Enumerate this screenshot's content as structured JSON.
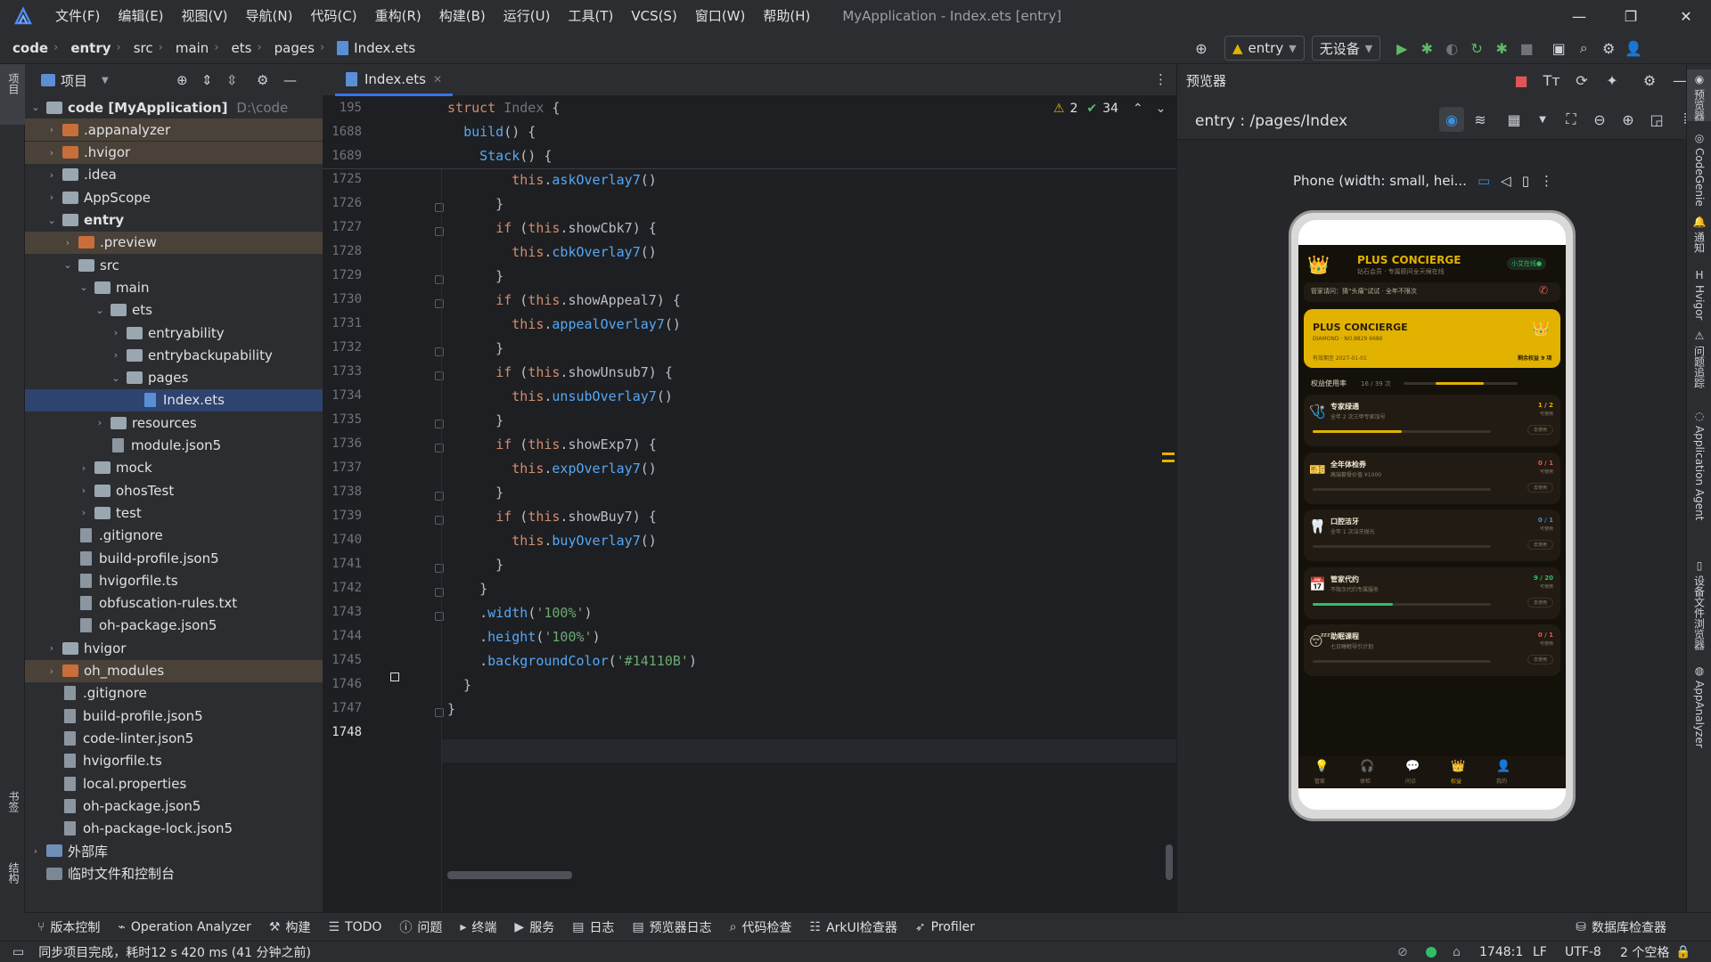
{
  "menu": [
    "文件(F)",
    "编辑(E)",
    "视图(V)",
    "导航(N)",
    "代码(C)",
    "重构(R)",
    "构建(B)",
    "运行(U)",
    "工具(T)",
    "VCS(S)",
    "窗口(W)",
    "帮助(H)"
  ],
  "window_title": "MyApplication - Index.ets [entry]",
  "breadcrumb": [
    "code",
    "entry",
    "src",
    "main",
    "ets",
    "pages",
    "Index.ets"
  ],
  "toolbar": {
    "module": "entry",
    "device": "无设备"
  },
  "left_strip": {
    "project": "项目",
    "bookmarks": "书签",
    "structure": "结构"
  },
  "project_panel": {
    "title": "项目",
    "tree": [
      {
        "label": "code [MyApplication]",
        "hint": "D:\\code"
      },
      {
        "label": ".appanalyzer"
      },
      {
        "label": ".hvigor"
      },
      {
        "label": ".idea"
      },
      {
        "label": "AppScope"
      },
      {
        "label": "entry"
      },
      {
        "label": ".preview"
      },
      {
        "label": "src"
      },
      {
        "label": "main"
      },
      {
        "label": "ets"
      },
      {
        "label": "entryability"
      },
      {
        "label": "entrybackupability"
      },
      {
        "label": "pages"
      },
      {
        "label": "Index.ets"
      },
      {
        "label": "resources"
      },
      {
        "label": "module.json5"
      },
      {
        "label": "mock"
      },
      {
        "label": "ohosTest"
      },
      {
        "label": "test"
      },
      {
        "label": ".gitignore"
      },
      {
        "label": "build-profile.json5"
      },
      {
        "label": "hvigorfile.ts"
      },
      {
        "label": "obfuscation-rules.txt"
      },
      {
        "label": "oh-package.json5"
      },
      {
        "label": "hvigor"
      },
      {
        "label": "oh_modules"
      },
      {
        "label": ".gitignore"
      },
      {
        "label": "build-profile.json5"
      },
      {
        "label": "code-linter.json5"
      },
      {
        "label": "hvigorfile.ts"
      },
      {
        "label": "local.properties"
      },
      {
        "label": "oh-package.json5"
      },
      {
        "label": "oh-package-lock.json5"
      },
      {
        "label": "外部库"
      },
      {
        "label": "临时文件和控制台"
      }
    ]
  },
  "editor": {
    "tab": "Index.ets",
    "warnings": "2",
    "checks": "34",
    "sticky_lines": [
      "195",
      "1688",
      "1689"
    ],
    "line_numbers": [
      "1725",
      "1726",
      "1727",
      "1728",
      "1729",
      "1730",
      "1731",
      "1732",
      "1733",
      "1734",
      "1735",
      "1736",
      "1737",
      "1738",
      "1739",
      "1740",
      "1741",
      "1742",
      "1743",
      "1744",
      "1745",
      "1746",
      "1747",
      "1748"
    ]
  },
  "preview": {
    "title": "预览器",
    "route": "entry : /pages/Index",
    "device_label": "Phone (width: small, hei...",
    "app": {
      "brand": "PLUS CONCIERGE",
      "brand_sub": "钻石会员 · 专属顾问全天候在线",
      "online": "小艾在线●",
      "notice": "管家请问：猜“头痛”试试 · 全年不限次",
      "card_title": "PLUS CONCIERGE",
      "card_no": "DIAMOND · NO.8829 6686",
      "card_valid": "有效期至 2027-01-01",
      "card_remain": "剩余权益 9 项",
      "usage_label": "权益使用率",
      "usage_count": "16 / 39 次",
      "usage_ratio": 0.6,
      "benefits": [
        {
          "title": "专家绿通",
          "desc": "全年 2 次三甲专家加号",
          "count": "1 / 2",
          "avail": "可使用",
          "btn": "去使用",
          "ratio": 0.5,
          "color": "#e2b200"
        },
        {
          "title": "全年体检券",
          "desc": "高端套餐价值 ¥1000",
          "count": "0 / 1",
          "avail": "可使用",
          "btn": "去使用",
          "ratio": 0.0,
          "color": "#e05a5a"
        },
        {
          "title": "口腔洁牙",
          "desc": "全年 1 次洁牙抛光",
          "count": "0 / 1",
          "avail": "可使用",
          "btn": "去使用",
          "ratio": 0.0,
          "color": "#3d8fe0"
        },
        {
          "title": "管家代约",
          "desc": "不限次代约专属服务",
          "count": "9 / 20",
          "avail": "可使用",
          "btn": "去使用",
          "ratio": 0.45,
          "color": "#2fbf6a"
        },
        {
          "title": "助眠课程",
          "desc": "七日睡眠导引计划",
          "count": "0 / 1",
          "avail": "可使用",
          "btn": "去使用",
          "ratio": 0.0,
          "color": "#e05a5a"
        }
      ],
      "tabs": [
        "管家",
        "体检",
        "问诊",
        "权益",
        "我的"
      ]
    }
  },
  "right_strip": [
    "预览器",
    "CodeGenie",
    "通知",
    "Hvigor",
    "问题追踪",
    "Application Agent",
    "设备文件浏览器",
    "AppAnalyzer"
  ],
  "bottom_tools": [
    "版本控制",
    "Operation Analyzer",
    "构建",
    "TODO",
    "问题",
    "终端",
    "服务",
    "日志",
    "预览器日志",
    "代码检查",
    "ArkUI检查器",
    "Profiler",
    "数据库检查器"
  ],
  "status": {
    "message": "同步项目完成，耗时12 s 420 ms (41 分钟之前)",
    "position": "1748:1",
    "line_sep": "LF",
    "encoding": "UTF-8",
    "indent": "2 个空格"
  },
  "colors": {
    "accent": "#3574f0",
    "gold": "#e2b200",
    "app_bg": "#14110b"
  }
}
